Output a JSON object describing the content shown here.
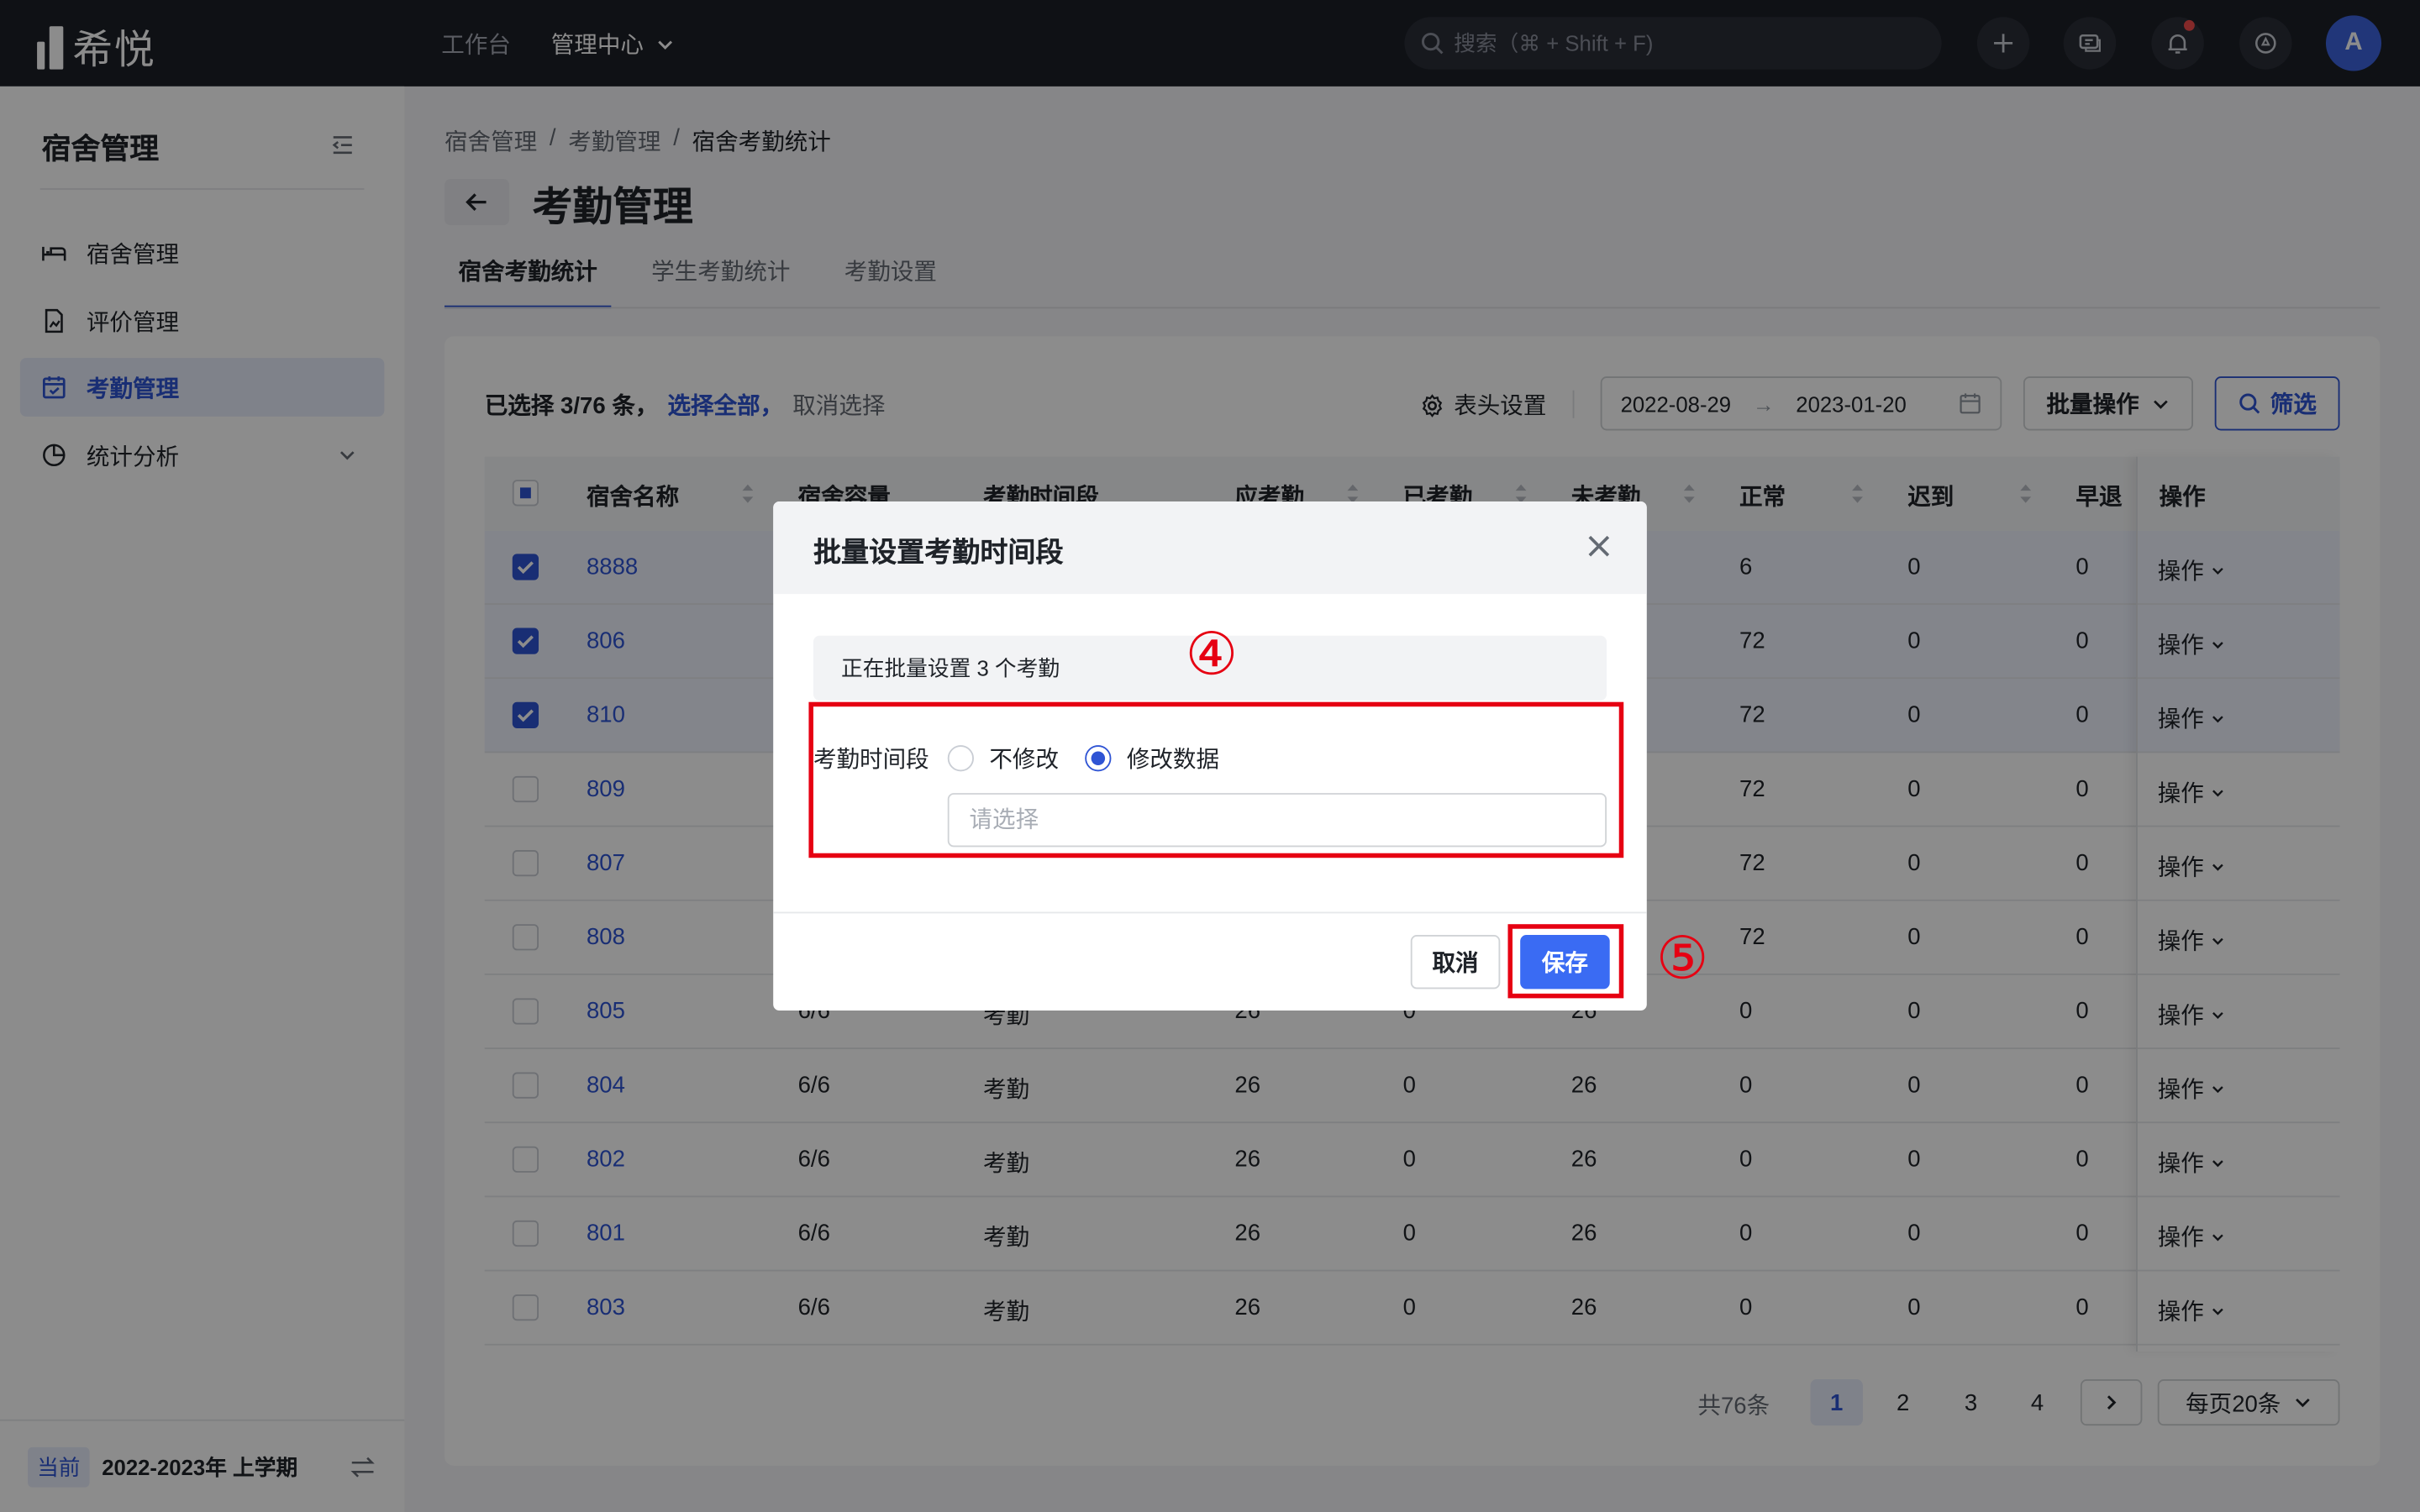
{
  "topbar": {
    "logo_text": "希悦",
    "nav": [
      "工作台",
      "管理中心"
    ],
    "search_placeholder": "搜索（⌘ + Shift + F)",
    "avatar": "A"
  },
  "sidebar": {
    "title": "宿舍管理",
    "items": [
      {
        "label": "宿舍管理",
        "icon": "bed-icon"
      },
      {
        "label": "评价管理",
        "icon": "document-chart-icon"
      },
      {
        "label": "考勤管理",
        "icon": "calendar-icon",
        "active": true
      },
      {
        "label": "统计分析",
        "icon": "pie-chart-icon",
        "expandable": true
      }
    ],
    "footer_tag": "当前",
    "footer_term": "2022-2023年 上学期"
  },
  "breadcrumb": [
    "宿舍管理",
    "/",
    "考勤管理",
    "/",
    "宿舍考勤统计"
  ],
  "page_title": "考勤管理",
  "tabs": [
    "宿舍考勤统计",
    "学生考勤统计",
    "考勤设置"
  ],
  "toolbar": {
    "selected_text": "已选择 3/76 条，",
    "select_all": "选择全部，",
    "cancel_select": "取消选择",
    "header_settings": "表头设置",
    "date_start": "2022-08-29",
    "date_arrow": "→",
    "date_end": "2023-01-20",
    "batch": "批量操作",
    "filter": "筛选"
  },
  "table": {
    "columns": [
      "宿舍名称",
      "宿舍容量",
      "考勤时间段",
      "应考勤",
      "已考勤",
      "未考勤",
      "正常",
      "迟到",
      "早退",
      "操作"
    ],
    "rows": [
      {
        "name": "8888",
        "capacity": "",
        "period": "",
        "should": "",
        "done": "",
        "undone": "",
        "normal": "6",
        "late": "0",
        "early": "0",
        "op": "操作",
        "checked": true
      },
      {
        "name": "806",
        "capacity": "",
        "period": "",
        "should": "",
        "done": "",
        "undone": "",
        "normal": "72",
        "late": "0",
        "early": "0",
        "op": "操作",
        "checked": true
      },
      {
        "name": "810",
        "capacity": "",
        "period": "",
        "should": "",
        "done": "",
        "undone": "",
        "normal": "72",
        "late": "0",
        "early": "0",
        "op": "操作",
        "checked": true
      },
      {
        "name": "809",
        "capacity": "",
        "period": "",
        "should": "",
        "done": "",
        "undone": "",
        "normal": "72",
        "late": "0",
        "early": "0",
        "op": "操作",
        "checked": false
      },
      {
        "name": "807",
        "capacity": "",
        "period": "",
        "should": "",
        "done": "",
        "undone": "",
        "normal": "72",
        "late": "0",
        "early": "0",
        "op": "操作",
        "checked": false
      },
      {
        "name": "808",
        "capacity": "",
        "period": "",
        "should": "",
        "done": "",
        "undone": "",
        "normal": "72",
        "late": "0",
        "early": "0",
        "op": "操作",
        "checked": false
      },
      {
        "name": "805",
        "capacity": "6/6",
        "period": "考勤",
        "should": "26",
        "done": "0",
        "undone": "26",
        "normal": "0",
        "late": "0",
        "early": "0",
        "op": "操作",
        "checked": false
      },
      {
        "name": "804",
        "capacity": "6/6",
        "period": "考勤",
        "should": "26",
        "done": "0",
        "undone": "26",
        "normal": "0",
        "late": "0",
        "early": "0",
        "op": "操作",
        "checked": false
      },
      {
        "name": "802",
        "capacity": "6/6",
        "period": "考勤",
        "should": "26",
        "done": "0",
        "undone": "26",
        "normal": "0",
        "late": "0",
        "early": "0",
        "op": "操作",
        "checked": false
      },
      {
        "name": "801",
        "capacity": "6/6",
        "period": "考勤",
        "should": "26",
        "done": "0",
        "undone": "26",
        "normal": "0",
        "late": "0",
        "early": "0",
        "op": "操作",
        "checked": false
      },
      {
        "name": "803",
        "capacity": "6/6",
        "period": "考勤",
        "should": "26",
        "done": "0",
        "undone": "26",
        "normal": "0",
        "late": "0",
        "early": "0",
        "op": "操作",
        "checked": false
      }
    ]
  },
  "pagination": {
    "total": "共76条",
    "pages": [
      "1",
      "2",
      "3",
      "4"
    ],
    "current": "1",
    "page_size": "每页20条"
  },
  "modal": {
    "title": "批量设置考勤时间段",
    "info": "正在批量设置 3 个考勤",
    "field_label": "考勤时间段",
    "option_keep": "不修改",
    "option_modify": "修改数据",
    "selected_option": "修改数据",
    "select_placeholder": "请选择",
    "cancel": "取消",
    "save": "保存"
  },
  "annotations": {
    "step4": "④",
    "step5": "⑤",
    "highlight_color": "#e60012"
  },
  "colors": {
    "accent": "#2f54d4",
    "primary_button": "#3a6bf3",
    "topbar": "#1c1f27"
  }
}
